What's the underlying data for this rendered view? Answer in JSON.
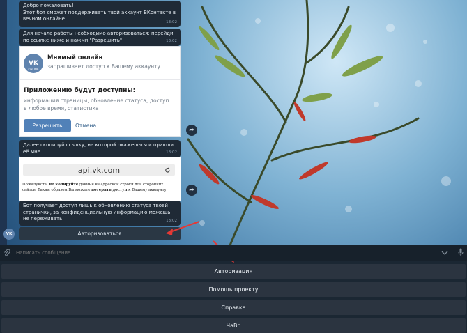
{
  "messages": {
    "welcome": {
      "line1": "Добро пожаловать!",
      "line2": "Этот бот сможет поддерживать твой аккаунт ВКонтакте в вечном онлайне.",
      "time": "13:02"
    },
    "start": {
      "text": "Для начала работы необходимо авторизоваться: перейди по ссылке ниже и нажми \"Разрешить\"",
      "time": "13:02"
    },
    "copy": {
      "text": "Далее скопируй ссылку, на которой окажешься и пришли её мне",
      "time": "13:02"
    },
    "status": {
      "text": "Бот получает доступ лишь к обновлению статуса твоей странички, за конфиденциальную информацию можешь не переживать",
      "time": "13:02"
    }
  },
  "card": {
    "logo": "VK",
    "logo_sub": "ONLINE",
    "app_name": "Мнимый онлайн",
    "subtitle": "запрашивает доступ к Вашему аккаунту",
    "permissions_title": "Приложению будут доступны:",
    "permissions_text": "информация страницы, обновление статуса, доступ в любое время, статистика",
    "allow": "Разрешить",
    "cancel": "Отмена"
  },
  "link_card": {
    "url": "api.vk.com",
    "note_part1": "Пожалуйста, ",
    "note_bold1": "не копируйте",
    "note_part2": " данные из адресной строки для сторонних сайтов. Таким образом Вы можете ",
    "note_bold2": "потерять доступ",
    "note_part3": " к Вашему аккаунту."
  },
  "inline_button": "Авторизоваться",
  "avatar": "VK",
  "input": {
    "placeholder": "Написать сообщение..."
  },
  "keyboard": [
    "Авторизация",
    "Помощь проекту",
    "Справка",
    "ЧаВо"
  ],
  "icons": {
    "share": "share-icon",
    "attach": "paperclip-icon",
    "voice": "microphone-icon",
    "expand": "chevron-down-icon",
    "refresh": "refresh-icon"
  },
  "colors": {
    "accent": "#5181b8",
    "arrow": "#e53935"
  }
}
